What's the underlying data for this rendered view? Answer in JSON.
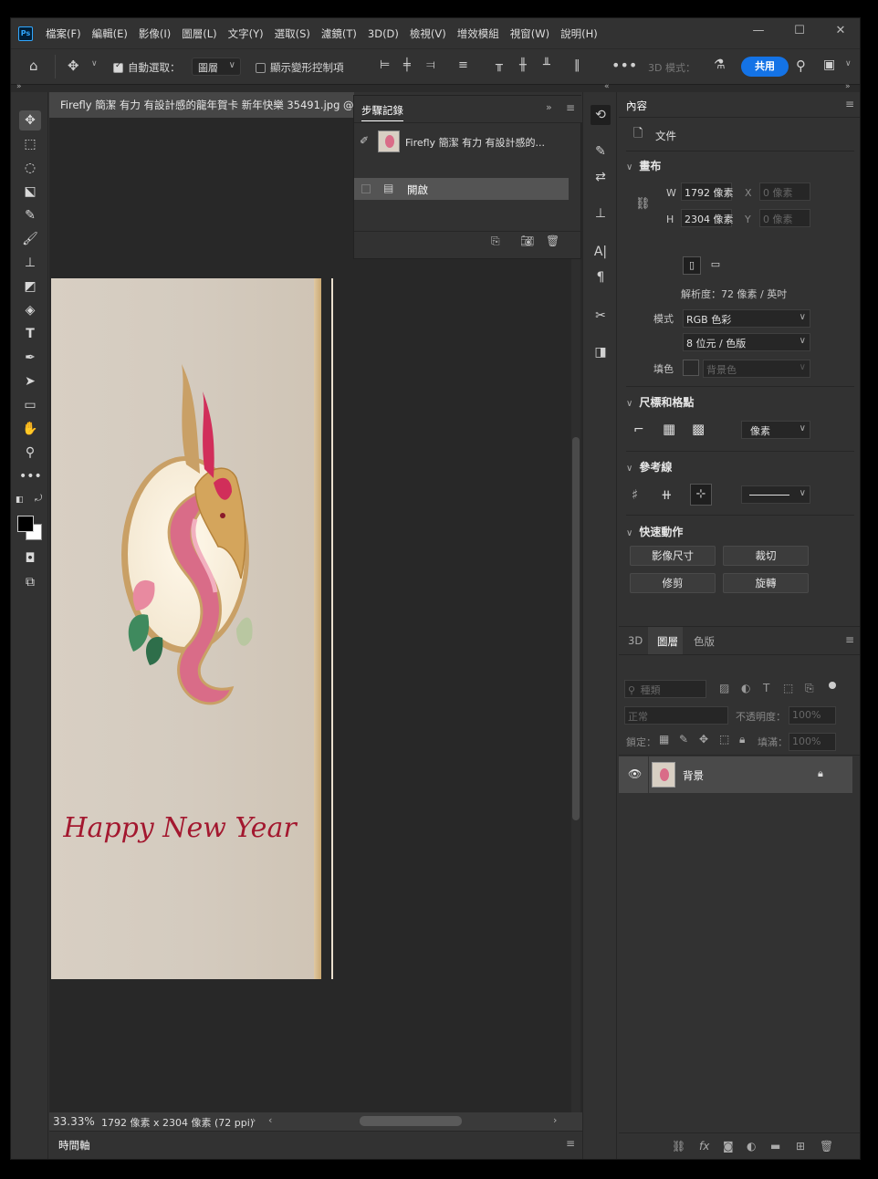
{
  "app": {
    "logo": "Ps"
  },
  "menu": [
    "檔案(F)",
    "編輯(E)",
    "影像(I)",
    "圖層(L)",
    "文字(Y)",
    "選取(S)",
    "濾鏡(T)",
    "3D(D)",
    "檢視(V)",
    "增效模組",
    "視窗(W)",
    "說明(H)"
  ],
  "options": {
    "auto_select_label": "自動選取：",
    "auto_select_value": "圖層",
    "show_transform_label": "顯示變形控制項",
    "mode_3d_label": "3D 模式：",
    "share_label": "共用"
  },
  "document": {
    "tab_title": "Firefly 簡潔 有力 有設計感的龍年賀卡 新年快樂 35491.jpg @",
    "zoom": "33.33%",
    "status": "1792 像素 x 2304 像素 (72 ppi)",
    "image_text": "Happy New Year"
  },
  "history": {
    "title": "步驟記錄",
    "snapshot_label": "Firefly 簡潔 有力 有設計感的...",
    "steps": [
      "開啟"
    ]
  },
  "timeline": {
    "label": "時間軸"
  },
  "properties": {
    "tab": "內容",
    "doc_type": "文件",
    "canvas": {
      "title": "畫布",
      "w_label": "W",
      "w_value": "1792 像素",
      "h_label": "H",
      "h_value": "2304 像素",
      "x_label": "X",
      "x_value": "0 像素",
      "y_label": "Y",
      "y_value": "0 像素",
      "resolution": "解析度：72 像素 / 英吋",
      "mode_label": "模式",
      "mode_value": "RGB 色彩",
      "depth_value": "8 位元 / 色版",
      "fill_label": "填色",
      "fill_value": "背景色"
    },
    "rulers": {
      "title": "尺標和格點",
      "unit": "像素"
    },
    "guides": {
      "title": "參考線"
    },
    "quick_actions": {
      "title": "快速動作",
      "buttons": [
        "影像尺寸",
        "裁切",
        "修剪",
        "旋轉"
      ]
    }
  },
  "layers": {
    "tabs": [
      "3D",
      "圖層",
      "色版"
    ],
    "active_tab": "圖層",
    "filter_label": "種類",
    "blend_mode": "正常",
    "opacity_label": "不透明度：",
    "opacity_value": "100%",
    "lock_label": "鎖定：",
    "fill_label": "填滿：",
    "fill_value": "100%",
    "items": [
      {
        "name": "背景",
        "visible": true,
        "locked": true
      }
    ]
  },
  "colors": {
    "accent": "#1473e6",
    "background": "#323232",
    "canvas": "#282828"
  }
}
